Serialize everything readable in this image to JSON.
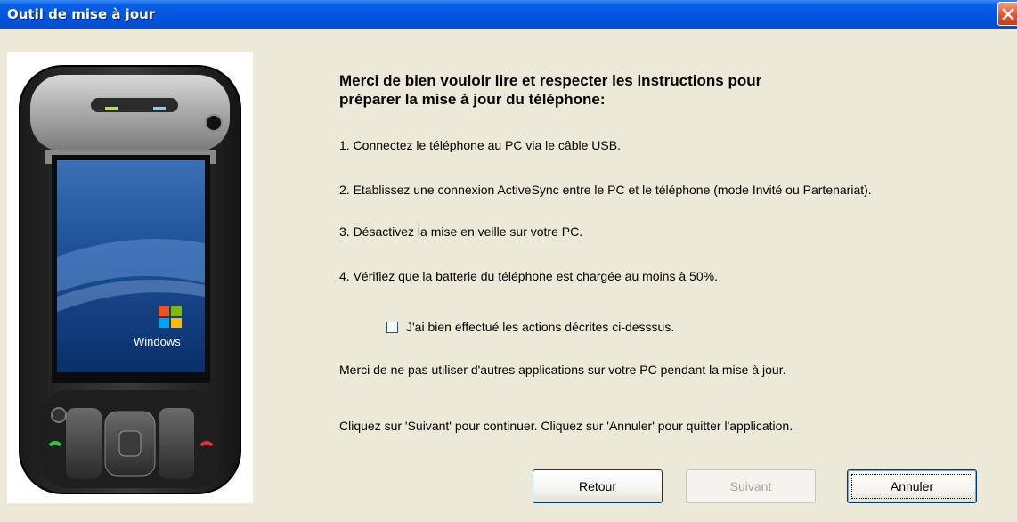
{
  "window": {
    "title": "Outil de mise à jour"
  },
  "image": {
    "os_logo_text": "Windows"
  },
  "main": {
    "heading_line1": "Merci de bien vouloir lire et respecter les instructions pour",
    "heading_line2": "préparer la mise à jour du téléphone:",
    "steps": [
      "1. Connectez le téléphone au PC via le câble USB.",
      "2. Etablissez une connexion ActiveSync entre le PC et le téléphone (mode Invité ou Partenariat).",
      "3. Désactivez la mise en veille sur votre PC.",
      "4. Vérifiez que la batterie du téléphone est chargée au moins à 50%."
    ],
    "confirm_checkbox": {
      "label": "J'ai bien effectué les actions décrites ci-desssus.",
      "checked": false
    },
    "warning": "Merci de ne pas utiliser d'autres applications sur votre PC pendant la mise à jour.",
    "instructions": "Cliquez sur 'Suivant' pour continuer. Cliquez sur 'Annuler' pour quitter l'application."
  },
  "buttons": {
    "back": "Retour",
    "next": "Suivant",
    "cancel": "Annuler"
  },
  "colors": {
    "titlebar": "#0456e0",
    "background": "#ece9d8",
    "close": "#e05a3a"
  }
}
